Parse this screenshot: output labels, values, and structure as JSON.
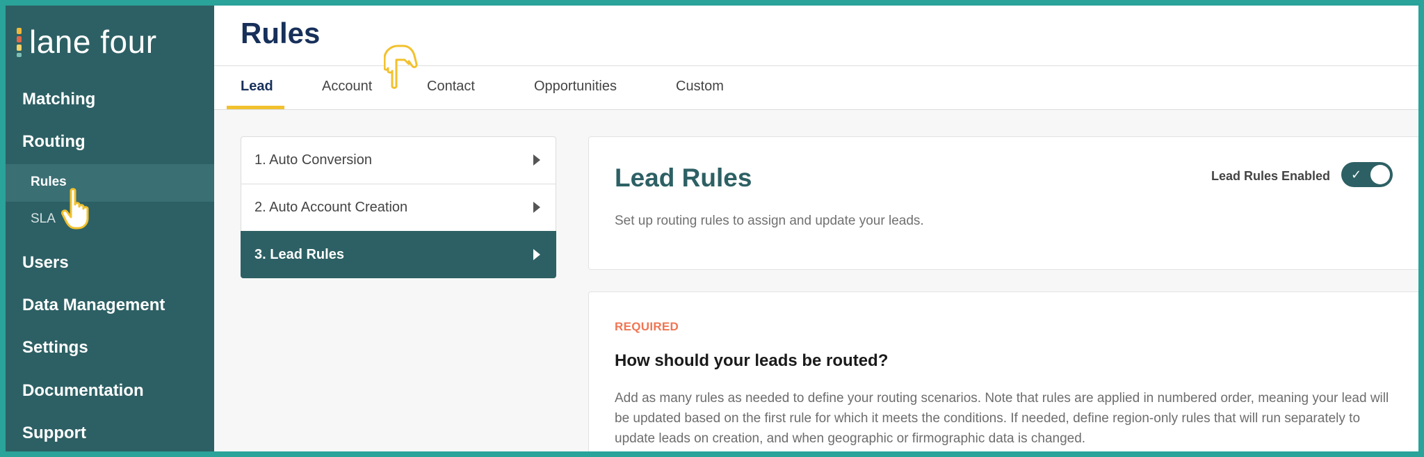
{
  "brand": {
    "name": "lane four"
  },
  "sidebar": {
    "items": [
      {
        "label": "Matching"
      },
      {
        "label": "Routing"
      },
      {
        "label": "Users"
      },
      {
        "label": "Data Management"
      },
      {
        "label": "Settings"
      },
      {
        "label": "Documentation"
      },
      {
        "label": "Support"
      }
    ],
    "routing_sub": [
      {
        "label": "Rules",
        "active": true
      },
      {
        "label": "SLA",
        "active": false
      }
    ]
  },
  "header": {
    "title": "Rules"
  },
  "tabs": [
    {
      "label": "Lead",
      "active": true
    },
    {
      "label": "Account"
    },
    {
      "label": "Contact"
    },
    {
      "label": "Opportunities"
    },
    {
      "label": "Custom"
    }
  ],
  "steps": [
    {
      "label": "1. Auto Conversion"
    },
    {
      "label": "2. Auto Account Creation"
    },
    {
      "label": "3. Lead Rules",
      "selected": true
    }
  ],
  "lead_rules_card": {
    "title": "Lead Rules",
    "description": "Set up routing rules to assign and update your leads.",
    "toggle_label": "Lead Rules Enabled",
    "toggle_on": true
  },
  "routing_card": {
    "tag": "REQUIRED",
    "question": "How should your leads be routed?",
    "explanation": "Add as many rules as needed to define your routing scenarios. Note that rules are applied in numbered order, meaning your lead will be updated based on the first rule for which it meets the conditions. If needed, define region-only rules that will run separately to update leads on creation, and when geographic or firmographic data is changed."
  },
  "colors": {
    "sidebar": "#2d6064",
    "accent_tab": "#f2c12e",
    "title": "#17305a",
    "required": "#f07552",
    "frame": "#2aa39a"
  }
}
